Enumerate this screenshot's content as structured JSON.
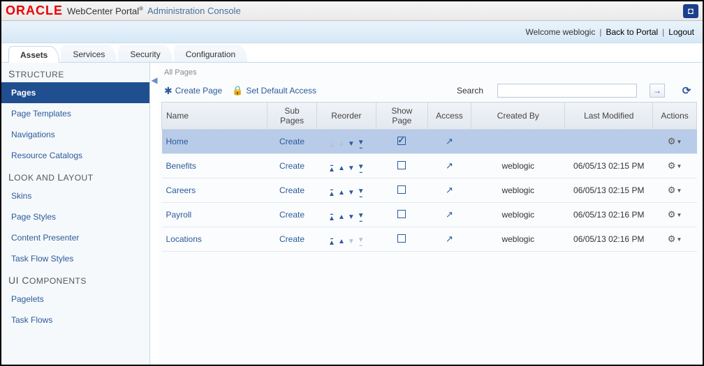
{
  "header": {
    "logo": "ORACLE",
    "product": "WebCenter Portal",
    "subtitle": "Administration Console"
  },
  "userbar": {
    "welcome": "Welcome weblogic",
    "back": "Back to Portal",
    "logout": "Logout"
  },
  "tabs": [
    "Assets",
    "Services",
    "Security",
    "Configuration"
  ],
  "sidebar": {
    "sections": [
      {
        "title": "Structure",
        "items": [
          "Pages",
          "Page Templates",
          "Navigations",
          "Resource Catalogs"
        ]
      },
      {
        "title": "Look and Layout",
        "items": [
          "Skins",
          "Page Styles",
          "Content Presenter",
          "Task Flow Styles"
        ]
      },
      {
        "title": "UI Components",
        "items": [
          "Pagelets",
          "Task Flows"
        ]
      }
    ]
  },
  "breadcrumb": "All Pages",
  "toolbar": {
    "create_page": "Create Page",
    "set_default_access": "Set Default Access",
    "search_label": "Search",
    "search_value": ""
  },
  "columns": {
    "name": "Name",
    "subpages": "Sub Pages",
    "reorder": "Reorder",
    "showpage": "Show Page",
    "access": "Access",
    "createdby": "Created By",
    "lastmodified": "Last Modified",
    "actions": "Actions"
  },
  "rows": [
    {
      "name": "Home",
      "subpages": "Create",
      "show": true,
      "createdby": "",
      "modified": "",
      "topDisabled": true,
      "botDisabled": false,
      "selected": true
    },
    {
      "name": "Benefits",
      "subpages": "Create",
      "show": false,
      "createdby": "weblogic",
      "modified": "06/05/13 02:15 PM",
      "topDisabled": false,
      "botDisabled": false,
      "selected": false
    },
    {
      "name": "Careers",
      "subpages": "Create",
      "show": false,
      "createdby": "weblogic",
      "modified": "06/05/13 02:15 PM",
      "topDisabled": false,
      "botDisabled": false,
      "selected": false
    },
    {
      "name": "Payroll",
      "subpages": "Create",
      "show": false,
      "createdby": "weblogic",
      "modified": "06/05/13 02:16 PM",
      "topDisabled": false,
      "botDisabled": false,
      "selected": false
    },
    {
      "name": "Locations",
      "subpages": "Create",
      "show": false,
      "createdby": "weblogic",
      "modified": "06/05/13 02:16 PM",
      "topDisabled": false,
      "botDisabled": true,
      "selected": false
    }
  ]
}
